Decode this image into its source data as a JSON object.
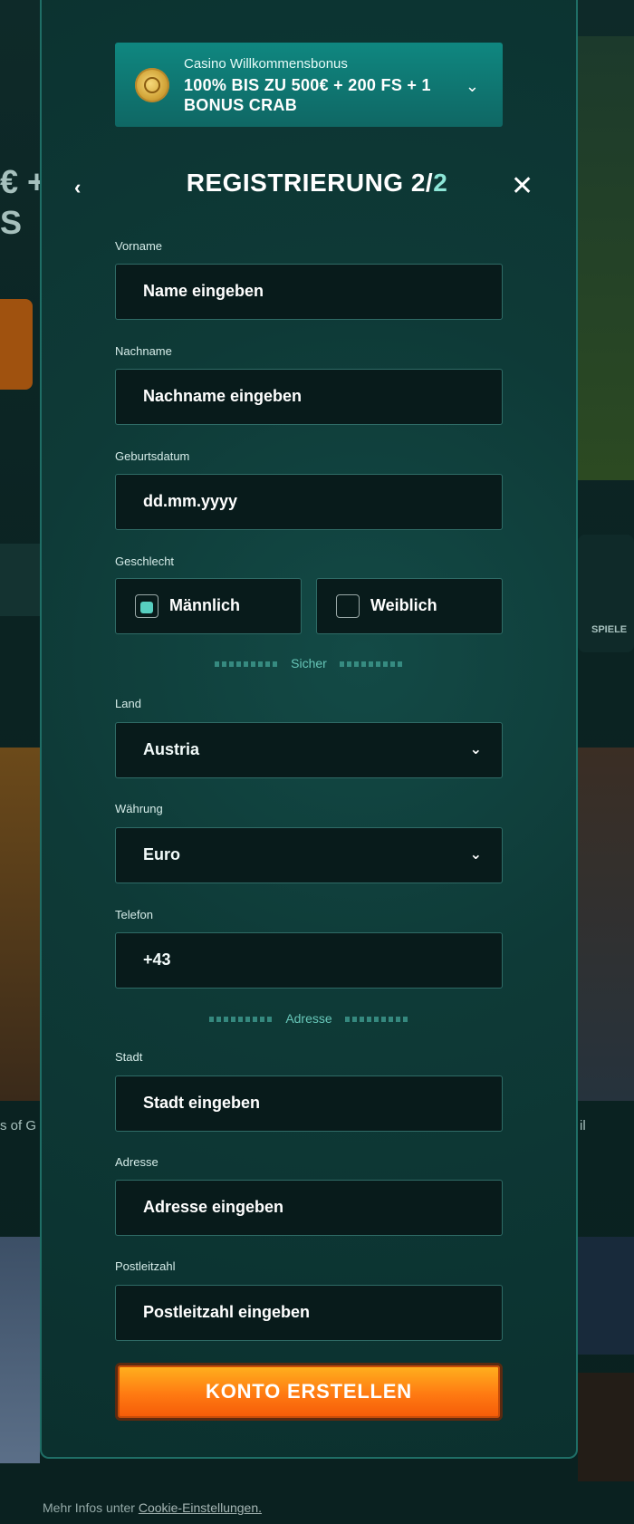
{
  "bonus": {
    "small": "Casino Willkommensbonus",
    "big": "100% BIS ZU 500€ + 200 FS + 1 BONUS CRAB",
    "icon": "coin-icon",
    "chevron_icon": "chevron-down-icon"
  },
  "header": {
    "title_main": "REGISTRIERUNG 2/",
    "title_accent": "2",
    "back_icon": "‹",
    "close_icon": "✕"
  },
  "form": {
    "vorname_label": "Vorname",
    "vorname_placeholder": "Name eingeben",
    "nachname_label": "Nachname",
    "nachname_placeholder": "Nachname eingeben",
    "geburtsdatum_label": "Geburtsdatum",
    "geburtsdatum_placeholder": "dd.mm.yyyy",
    "geschlecht_label": "Geschlecht",
    "gender_male": "Männlich",
    "gender_female": "Weiblich",
    "divider_sicher": "Sicher",
    "land_label": "Land",
    "land_value": "Austria",
    "waehrung_label": "Währung",
    "waehrung_value": "Euro",
    "telefon_label": "Telefon",
    "telefon_value": "+43",
    "divider_adresse": "Adresse",
    "stadt_label": "Stadt",
    "stadt_placeholder": "Stadt eingeben",
    "adresse_label": "Adresse",
    "adresse_placeholder": "Adresse eingeben",
    "plz_label": "Postleitzahl",
    "plz_placeholder": "Postleitzahl eingeben",
    "submit": "KONTO ERSTELLEN"
  },
  "footer": {
    "prefix": "Mehr Infos unter ",
    "link": "Cookie-Einstellungen."
  },
  "background": {
    "left_text_1": "€ +",
    "left_text_2": "S",
    "right_label": "SPIELE",
    "left_caption": "s of G",
    "right_caption": "il"
  },
  "colors": {
    "modal_bg": "#0e3a37",
    "accent": "#8de6d7",
    "cta_orange": "#ff7a12",
    "field_bg": "#081b1b"
  }
}
